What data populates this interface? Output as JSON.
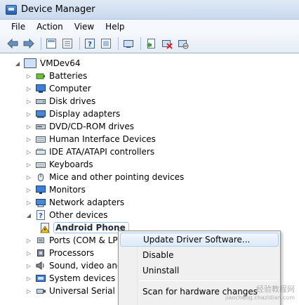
{
  "window": {
    "title": "Device Manager"
  },
  "menu": {
    "items": [
      "File",
      "Action",
      "View",
      "Help"
    ]
  },
  "toolbar": {
    "buttons": [
      "back-icon",
      "forward-icon",
      "properties-view-icon",
      "list-view-icon",
      "help-icon",
      "show-hidden-icon",
      "scan-icon",
      "update-driver-icon",
      "uninstall-icon",
      "disable-icon"
    ]
  },
  "tree": {
    "root": "VMDev64",
    "categories": [
      {
        "label": "Batteries",
        "icon": "battery-icon"
      },
      {
        "label": "Computer",
        "icon": "computer-icon"
      },
      {
        "label": "Disk drives",
        "icon": "disk-drive-icon"
      },
      {
        "label": "Display adapters",
        "icon": "display-adapter-icon"
      },
      {
        "label": "DVD/CD-ROM drives",
        "icon": "dvd-drive-icon"
      },
      {
        "label": "Human Interface Devices",
        "icon": "hid-icon"
      },
      {
        "label": "IDE ATA/ATAPI controllers",
        "icon": "ide-controller-icon"
      },
      {
        "label": "Keyboards",
        "icon": "keyboard-icon"
      },
      {
        "label": "Mice and other pointing devices",
        "icon": "mouse-icon"
      },
      {
        "label": "Monitors",
        "icon": "monitor-icon"
      },
      {
        "label": "Network adapters",
        "icon": "network-adapter-icon"
      },
      {
        "label": "Other devices",
        "icon": "unknown-device-icon"
      },
      {
        "label": "Android Phone",
        "icon": "warning-device-icon"
      },
      {
        "label": "Ports (COM & LPT",
        "icon": "ports-icon"
      },
      {
        "label": "Processors",
        "icon": "processor-icon"
      },
      {
        "label": "Sound, video and",
        "icon": "sound-icon"
      },
      {
        "label": "System devices",
        "icon": "system-device-icon"
      },
      {
        "label": "Universal Serial Bus",
        "icon": "usb-icon"
      }
    ]
  },
  "context_menu": {
    "items": [
      "Update Driver Software...",
      "Disable",
      "Uninstall",
      "Scan for hardware changes"
    ]
  },
  "watermark": {
    "main": "经验教程网",
    "sub": "jiaocheng.chazidian.com"
  },
  "colors": {
    "highlight_border": "#aecff7",
    "title_bar": "#c9d9ee"
  }
}
